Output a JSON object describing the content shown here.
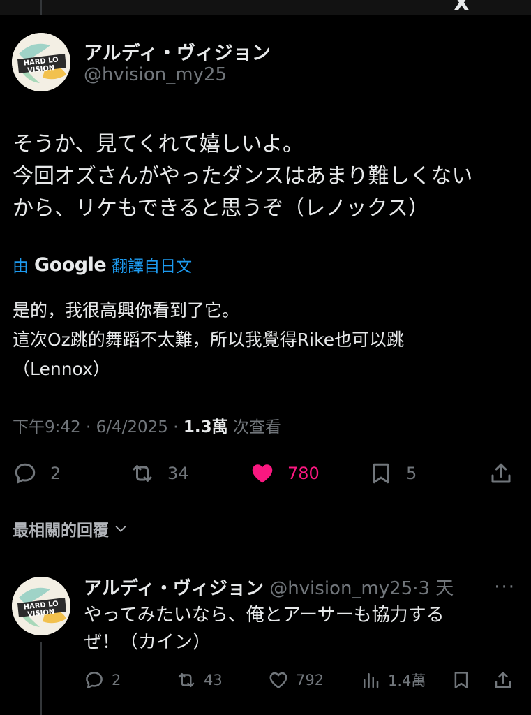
{
  "app": {
    "logo": "X"
  },
  "tweet": {
    "author_name": "アルディ・ヴィジョン",
    "author_handle": "@hvision_my25",
    "avatar_icon": "avatar-logo-icon",
    "text_lines": [
      "そうか、見てくれて嬉しいよ。",
      "今回オズさんがやったダンスはあまり難しくない",
      "から、リケもできると思うぞ（レノックス）"
    ],
    "translate": {
      "prefix": "由",
      "brand": "Google",
      "suffix": "翻譯自日文"
    },
    "translated_lines": [
      "是的，我很高興你看到了它。",
      "這次Oz跳的舞蹈不太難，所以我覺得Rike也可以跳",
      "（Lennox）"
    ],
    "meta": {
      "time_date": "下午9:42 · 6/4/2025 · ",
      "views": "1.3萬",
      "views_suffix": " 次查看"
    },
    "actions": {
      "replies": "2",
      "retweets": "34",
      "likes": "780",
      "bookmarks": "5"
    },
    "colors": {
      "like": "#f91880",
      "link": "#1d9bf0",
      "muted": "#71767b"
    }
  },
  "replies_filter": {
    "label": "最相關的回覆"
  },
  "reply": {
    "author_name": "アルディ・ヴィジョン",
    "author_handle": "@hvision_my25·3 天",
    "more": "···",
    "text_lines": [
      "やってみたいなら、俺とアーサーも協力する",
      "ぜ！（カイン）"
    ],
    "actions": {
      "replies": "2",
      "retweets": "43",
      "likes": "792",
      "views": "1.4萬"
    }
  }
}
